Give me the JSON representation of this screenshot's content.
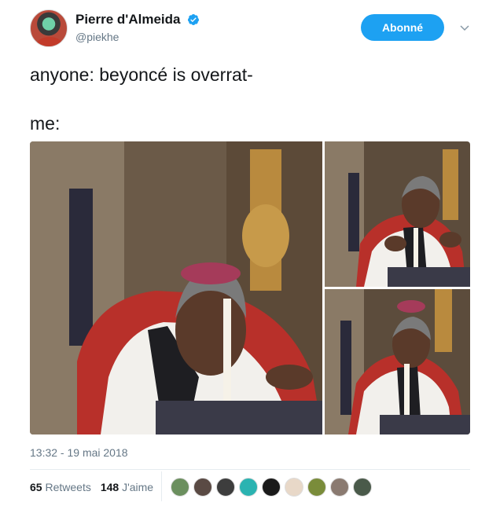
{
  "author": {
    "display_name": "Pierre d'Almeida",
    "handle": "@piekhe",
    "verified": true
  },
  "follow_button": {
    "label": "Abonné"
  },
  "tweet": {
    "text_line1": "anyone: beyoncé is overrat-",
    "text_line2": "me:"
  },
  "timestamp": "13:32 - 19 mai 2018",
  "stats": {
    "retweets_count": "65",
    "retweets_label": "Retweets",
    "likes_count": "148",
    "likes_label": "J'aime"
  },
  "liker_colors": [
    "#6b8f5e",
    "#5a4a44",
    "#3d3d3d",
    "#2bb3b1",
    "#1a1a1a",
    "#e8d8c8",
    "#7a8c3a",
    "#8a7a70",
    "#4a5a4a"
  ],
  "colors": {
    "accent": "#1da1f2",
    "muted": "#657786",
    "text": "#14171a"
  },
  "icons": {
    "verified": "verified-badge-icon",
    "caret": "chevron-down-icon"
  }
}
